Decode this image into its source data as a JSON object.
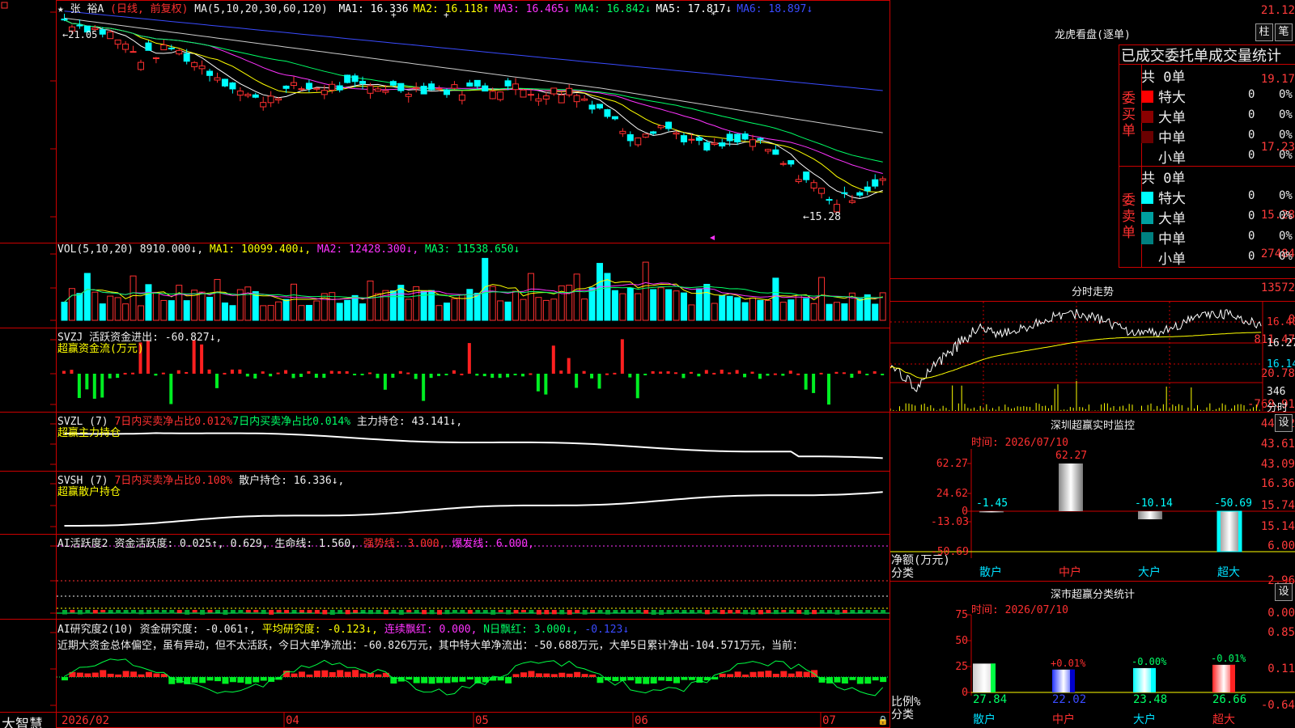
{
  "main_chart": {
    "title_star": "★",
    "stock_name": "张 裕A",
    "period_label": "(日线, 前复权)",
    "ma_group": "MA(5,10,20,30,60,120)",
    "ma_items": [
      {
        "label": "MA1:",
        "value": "16.336",
        "dir": "",
        "color": "#ffffff"
      },
      {
        "label": "MA2:",
        "value": "16.118",
        "dir": "↑",
        "color": "#ffff00"
      },
      {
        "label": "MA3:",
        "value": "16.465",
        "dir": "↓",
        "color": "#ff33ff"
      },
      {
        "label": "MA4:",
        "value": "16.842",
        "dir": "↓",
        "color": "#00ff66"
      },
      {
        "label": "MA5:",
        "value": "17.817",
        "dir": "↓",
        "color": "#ffffff"
      },
      {
        "label": "MA6:",
        "value": "18.897",
        "dir": "↓",
        "color": "#3a4bff"
      }
    ],
    "y_labels": [
      "21.12",
      "19.17",
      "17.23",
      "15.28"
    ],
    "high_label": "←21.05",
    "low_label": "←15.28"
  },
  "vol_chart": {
    "header_name": "VOL(5,10,20)",
    "header_value": "8910.000↓,",
    "ma1": "MA1: 10099.400↓,",
    "ma2": "MA2: 12428.300↓,",
    "ma3": "MA3: 11538.650↓",
    "y_labels": [
      "27484",
      "13572",
      "0"
    ]
  },
  "svzj": {
    "header": "SVZJ  活跃资金进出: -60.827↓,",
    "subtitle": "超赢资金流(万元)",
    "y_labels": [
      "811.47",
      "20.78",
      "-769.91"
    ]
  },
  "svzl": {
    "name": "SVZL (7)",
    "item1": "7日内买卖净占比0.012%",
    "item2": "7日内买卖净占比0.014%",
    "item3": "主力持仓: 43.141↓,",
    "subtitle": "超赢主力持仓",
    "y_labels": [
      "44.12",
      "43.61",
      "43.09"
    ]
  },
  "svsh": {
    "name": "SVSH (7)",
    "item1": "7日内买卖净占比0.108%",
    "item2": "散户持仓: 16.336↓,",
    "subtitle": "超赢散户持仓",
    "y_labels": [
      "16.36",
      "15.74",
      "15.14"
    ]
  },
  "ai_active": {
    "name": "AI活跃度2",
    "item1": "资金活跃度: 0.025↑, 0.629,",
    "item2": "生命线: 1.560,",
    "item3": "强势线: 3.000,",
    "item4": "爆发线: 6.000,",
    "y_labels": [
      "6.00",
      "2.96",
      "0.00"
    ]
  },
  "ai_research": {
    "name": "AI研究度2(10)",
    "item1": "资金研究度: -0.061↑,",
    "item2": "平均研究度: -0.123↓,",
    "item3": "连续飘红: 0.000,",
    "item4": "N日飘红: 3.000↓,",
    "item5": "-0.123↓",
    "comment": "近期大资金总体偏空，虽有异动，但不太活跃，今日大单净流出：-60.826万元，其中特大单净流出：-50.688万元，大单5日累计净出-104.571万元，当前：",
    "y_labels": [
      "0.85",
      "0.11",
      "-0.64"
    ]
  },
  "x_axis": {
    "brand": "大智慧",
    "labels": [
      "2026/02",
      "04",
      "05",
      "06",
      "07"
    ]
  },
  "right_panel": {
    "lhb": {
      "title": "龙虎看盘(逐单)",
      "btn_zhu": "柱",
      "btn_bi": "笔",
      "header": "已成交委托单成交量统计",
      "buy_label": "委买单",
      "sell_label": "委卖单",
      "buy_total": "共 0单",
      "sell_total": "共 0单",
      "buy_rows": [
        {
          "name": "特大",
          "count": "0",
          "pct": "0%",
          "color": "#ff0000"
        },
        {
          "name": "大单",
          "count": "0",
          "pct": "0%",
          "color": "#8a0000"
        },
        {
          "name": "中单",
          "count": "0",
          "pct": "0%",
          "color": "#6a0000"
        },
        {
          "name": "小单",
          "count": "0",
          "pct": "0%",
          "color": ""
        }
      ],
      "sell_rows": [
        {
          "name": "特大",
          "count": "0",
          "pct": "0%",
          "color": "#00ffff"
        },
        {
          "name": "大单",
          "count": "0",
          "pct": "0%",
          "color": "#00a0a0"
        },
        {
          "name": "中单",
          "count": "0",
          "pct": "0%",
          "color": "#008080"
        },
        {
          "name": "小单",
          "count": "0",
          "pct": "0%",
          "color": ""
        }
      ]
    },
    "intraday": {
      "title": "分时走势",
      "y_labels": [
        "16.40",
        "16.27",
        "16.14"
      ],
      "vol_label": "346",
      "vol_unit": "分时"
    },
    "monitor": {
      "title": "深圳超赢实时监控",
      "btn": "设",
      "time_label": "时间: 2026/07/10",
      "y_labels": [
        "62.27",
        "24.62",
        "0",
        "-13.03",
        "-50.69"
      ],
      "axis_label": "净额(万元)",
      "cat_label": "分类",
      "chart_data": {
        "type": "bar",
        "categories": [
          "散户",
          "中户",
          "大户",
          "超大"
        ],
        "values": [
          -1.45,
          62.27,
          -10.14,
          -50.69
        ],
        "value_labels": [
          "-1.45",
          "62.27",
          "-10.14",
          "-50.69"
        ],
        "ylim": [
          -50.69,
          62.27
        ],
        "ylabel": "净额(万元)"
      }
    },
    "classify": {
      "title": "深市超赢分类统计",
      "btn": "设",
      "time_label": "时间: 2026/07/10",
      "y_labels": [
        "75",
        "50",
        "25",
        "0"
      ],
      "axis_label": "比例%",
      "cat_label": "分类",
      "chart_data": {
        "type": "bar",
        "categories": [
          "散户",
          "中户",
          "大户",
          "超大"
        ],
        "values": [
          27.84,
          22.02,
          23.48,
          26.66
        ],
        "change_labels": [
          "",
          "+0.01%",
          "-0.00%",
          "-0.01%"
        ],
        "ylim": [
          0,
          75
        ],
        "ylabel": "比例%"
      }
    }
  }
}
